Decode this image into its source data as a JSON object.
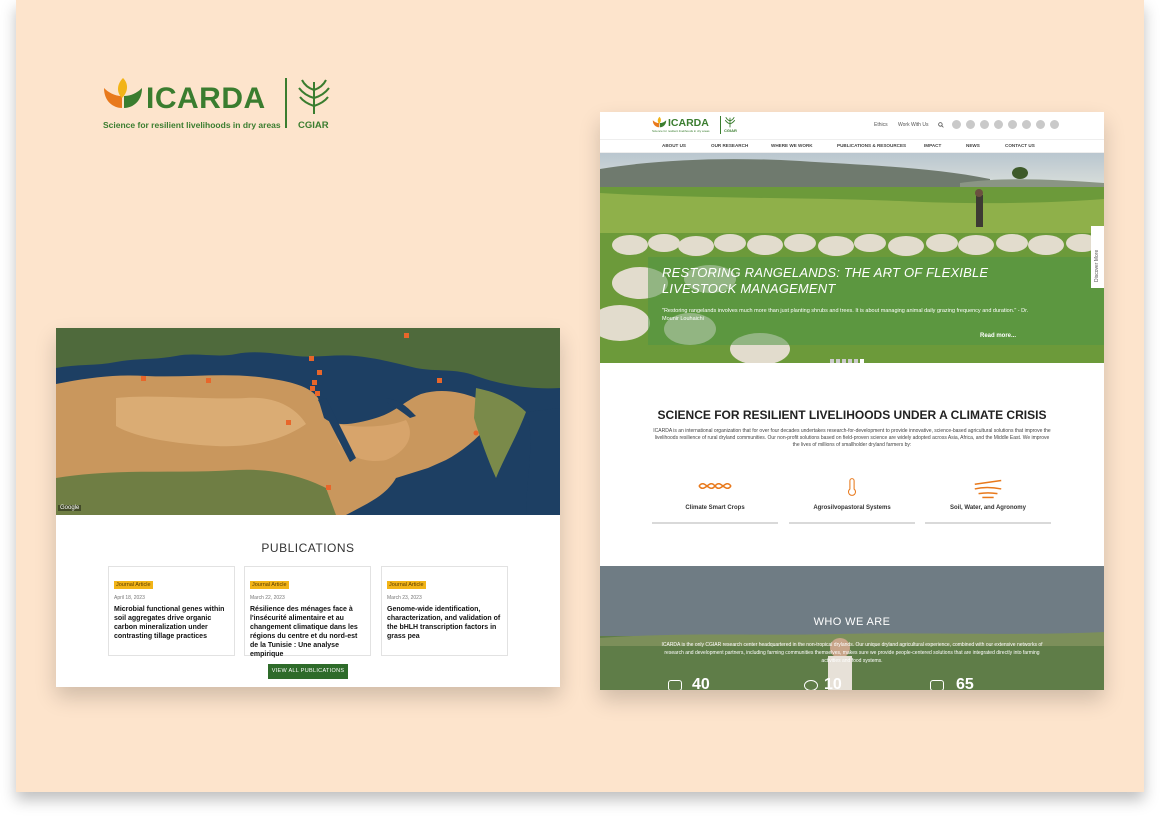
{
  "brand": {
    "name": "ICARDA",
    "tagline": "Science for resilient livelihoods in dry areas",
    "partner": "CGIAR",
    "colors": {
      "green": "#3a7d2f",
      "orange": "#e8791c",
      "yellow": "#f2b418"
    }
  },
  "left_mockup": {
    "map_credit": "Google",
    "publications_title": "PUBLICATIONS",
    "publications": [
      {
        "badge": "Journal Article",
        "date": "April 18, 2023",
        "title": "Microbial functional genes within soil aggregates drive organic carbon mineralization under contrasting tillage practices"
      },
      {
        "badge": "Journal Article",
        "date": "March 22, 2023",
        "title": "Résilience des ménages face à l'insécurité alimentaire et au changement climatique dans les régions du centre et du nord-est de la Tunisie : Une analyse empirique"
      },
      {
        "badge": "Journal Article",
        "date": "March 23, 2023",
        "title": "Genome-wide identification, characterization, and validation of the bHLH transcription factors in grass pea"
      }
    ],
    "view_all_label": "VIEW ALL PUBLICATIONS"
  },
  "site": {
    "logo_name": "ICARDA",
    "logo_tagline": "Science for resilient livelihoods in dry areas",
    "logo_partner": "CGIAR",
    "util_links": [
      "Ethics",
      "Work With Us"
    ],
    "search_icon": "search-icon",
    "social_icons": [
      "twitter-icon",
      "facebook-icon",
      "linkedin-icon",
      "instagram-icon",
      "flickr-icon",
      "youtube-icon",
      "rss-icon",
      "podcast-icon"
    ],
    "nav": [
      "ABOUT US",
      "OUR RESEARCH",
      "WHERE WE WORK",
      "PUBLICATIONS & RESOURCES",
      "IMPACT",
      "NEWS",
      "CONTACT US"
    ],
    "hero": {
      "title": "RESTORING RANGELANDS: THE ART OF FLEXIBLE LIVESTOCK MANAGEMENT",
      "quote": "\"Restoring rangelands involves much more than just planting shrubs and trees. It is about managing animal daily grazing frequency and duration.\" - Dr. Mounir Louhaichi",
      "more": "Read more...",
      "discover": "Discover More",
      "slides": 6
    },
    "mission": {
      "title": "SCIENCE FOR RESILIENT LIVELIHOODS UNDER A CLIMATE CRISIS",
      "body": "ICARDA is an international organization that for over four decades undertakes research-for-development to provide innovative, science-based agricultural solutions that improve the livelihoods resilience of rural dryland communities. Our non-profit solutions based on field-proven science are widely adopted across Asia, Africa, and the Middle East. We improve the lives of millions of smallholder dryland farmers by:"
    },
    "pillars": [
      {
        "label": "Climate Smart Crops",
        "icon": "dna-icon"
      },
      {
        "label": "Agrosilvopastoral Systems",
        "icon": "thermometer-icon"
      },
      {
        "label": "Soil, Water, and Agronomy",
        "icon": "water-soil-icon"
      }
    ],
    "who": {
      "title": "WHO WE ARE",
      "body": "ICARDA is the only CGIAR research center headquartered in the non-tropical drylands. Our unique dryland agricultural experience, combined with our extensive networks of research and development partners, including farming communities themselves, makes sure we provide people-centered solutions that are integrated directly into farming activities and food systems.",
      "stats": [
        "40",
        "10",
        "65"
      ]
    }
  }
}
